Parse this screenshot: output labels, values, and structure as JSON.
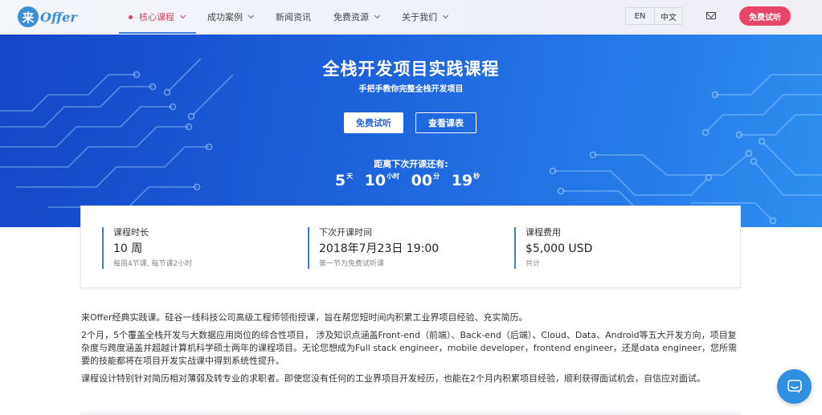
{
  "nav": {
    "logo_glyph": "来",
    "logo_text": "Offer",
    "items": [
      {
        "label": "核心课程",
        "active": true
      },
      {
        "label": "成功案例"
      },
      {
        "label": "新闻资讯"
      },
      {
        "label": "免费资源"
      },
      {
        "label": "关于我们"
      }
    ],
    "lang_en": "EN",
    "lang_zh": "中文",
    "mail_icon": "mail-icon",
    "trial_button": "免费试听"
  },
  "hero": {
    "title": "全栈开发项目实践课程",
    "subtitle": "手把手教你完整全栈开发项目",
    "btn_trial": "免费试听",
    "btn_schedule": "查看课表",
    "countdown_label": "距离下次开课还有:",
    "countdown": {
      "days": "5",
      "days_unit": "天",
      "hours": "10",
      "hours_unit": "小时",
      "minutes": "00",
      "minutes_unit": "分",
      "seconds": "19",
      "seconds_unit": "秒"
    }
  },
  "info": [
    {
      "label": "课程时长",
      "value": "10 周",
      "note": "每周4节课, 每节课2小时"
    },
    {
      "label": "下次开课时间",
      "value": "2018年7月23日 19:00",
      "note": "第一节为免费试听课"
    },
    {
      "label": "课程费用",
      "value": "$5,000 USD",
      "note": "共计"
    }
  ],
  "content": {
    "p1": "来Offer经典实践课。硅谷一线科技公司高级工程师领衔授课，旨在帮您短时间内积累工业界项目经验、充实简历。",
    "p2": "2个月，5个覆盖全栈开发与大数据应用岗位的综合性项目， 涉及知识点涵盖Front-end（前端）、Back-end（后端）、Cloud、Data、Android等五大开发方向，项目复杂度与跨度涵盖并超越计算机科学硕士两年的课程项目。无论您想成为Full stack engineer，mobile developer，frontend engineer，还是data engineer，您所需要的技能都将在项目开发实战课中得到系统性提升。",
    "p3": "课程设计特别针对简历相对薄弱及转专业的求职者。即使您没有任何的工业界项目开发经历，也能在2个月内积累项目经验，顺利获得面试机会，自信应对面试。"
  },
  "chat_icon": "chat-icon",
  "colors": {
    "accent": "#e8456b",
    "brand_blue": "#3b7fd6",
    "hero_start": "#1446c8",
    "hero_end": "#2f8ef0"
  }
}
